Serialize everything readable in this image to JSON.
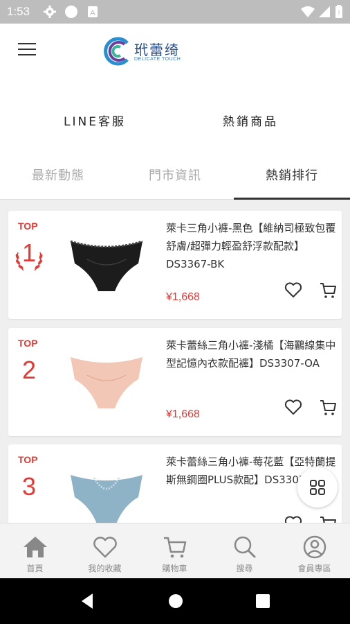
{
  "status_bar": {
    "time": "1:53",
    "icons": [
      "gear-icon",
      "circle-icon",
      "a-icon",
      "wifi-icon",
      "signal-icon",
      "battery-icon"
    ]
  },
  "header": {
    "logo_text": "玳蕾绮",
    "logo_subtitle": "DELICATE TOUCH",
    "menu_icon": "hamburger-icon"
  },
  "quick_links": {
    "line": "LINE客服",
    "hot": "熱銷商品"
  },
  "tabs": [
    {
      "label": "最新動態",
      "active": false
    },
    {
      "label": "門市資訊",
      "active": false
    },
    {
      "label": "熱銷排行",
      "active": true
    }
  ],
  "products": [
    {
      "rank_label": "TOP",
      "rank": "1",
      "name": "萊卡三角小褲-黑色【維納司極致包覆舒膚/超彈力輕盈舒浮款配款】DS3367-BK",
      "price": "¥1,668",
      "color": "#1c1c1c"
    },
    {
      "rank_label": "TOP",
      "rank": "2",
      "name": "萊卡蕾絲三角小褲-淺橘【海鸝線集中型記憶內衣款配褲】DS3307-OA",
      "price": "¥1,668",
      "color": "#f3c7b5"
    },
    {
      "rank_label": "TOP",
      "rank": "3",
      "name": "萊卡蕾絲三角小褲-莓花藍【亞特蘭提斯無鋼圈PLUS款配】DS3307",
      "price": "",
      "color": "#8fb3c6"
    }
  ],
  "bottom_nav": [
    {
      "label": "首頁",
      "icon": "home-icon"
    },
    {
      "label": "我的收藏",
      "icon": "heart-icon"
    },
    {
      "label": "購物車",
      "icon": "cart-icon"
    },
    {
      "label": "搜尋",
      "icon": "search-icon"
    },
    {
      "label": "會員專區",
      "icon": "user-icon"
    }
  ],
  "colors": {
    "accent": "#e53935",
    "logo": "#234a8c"
  }
}
